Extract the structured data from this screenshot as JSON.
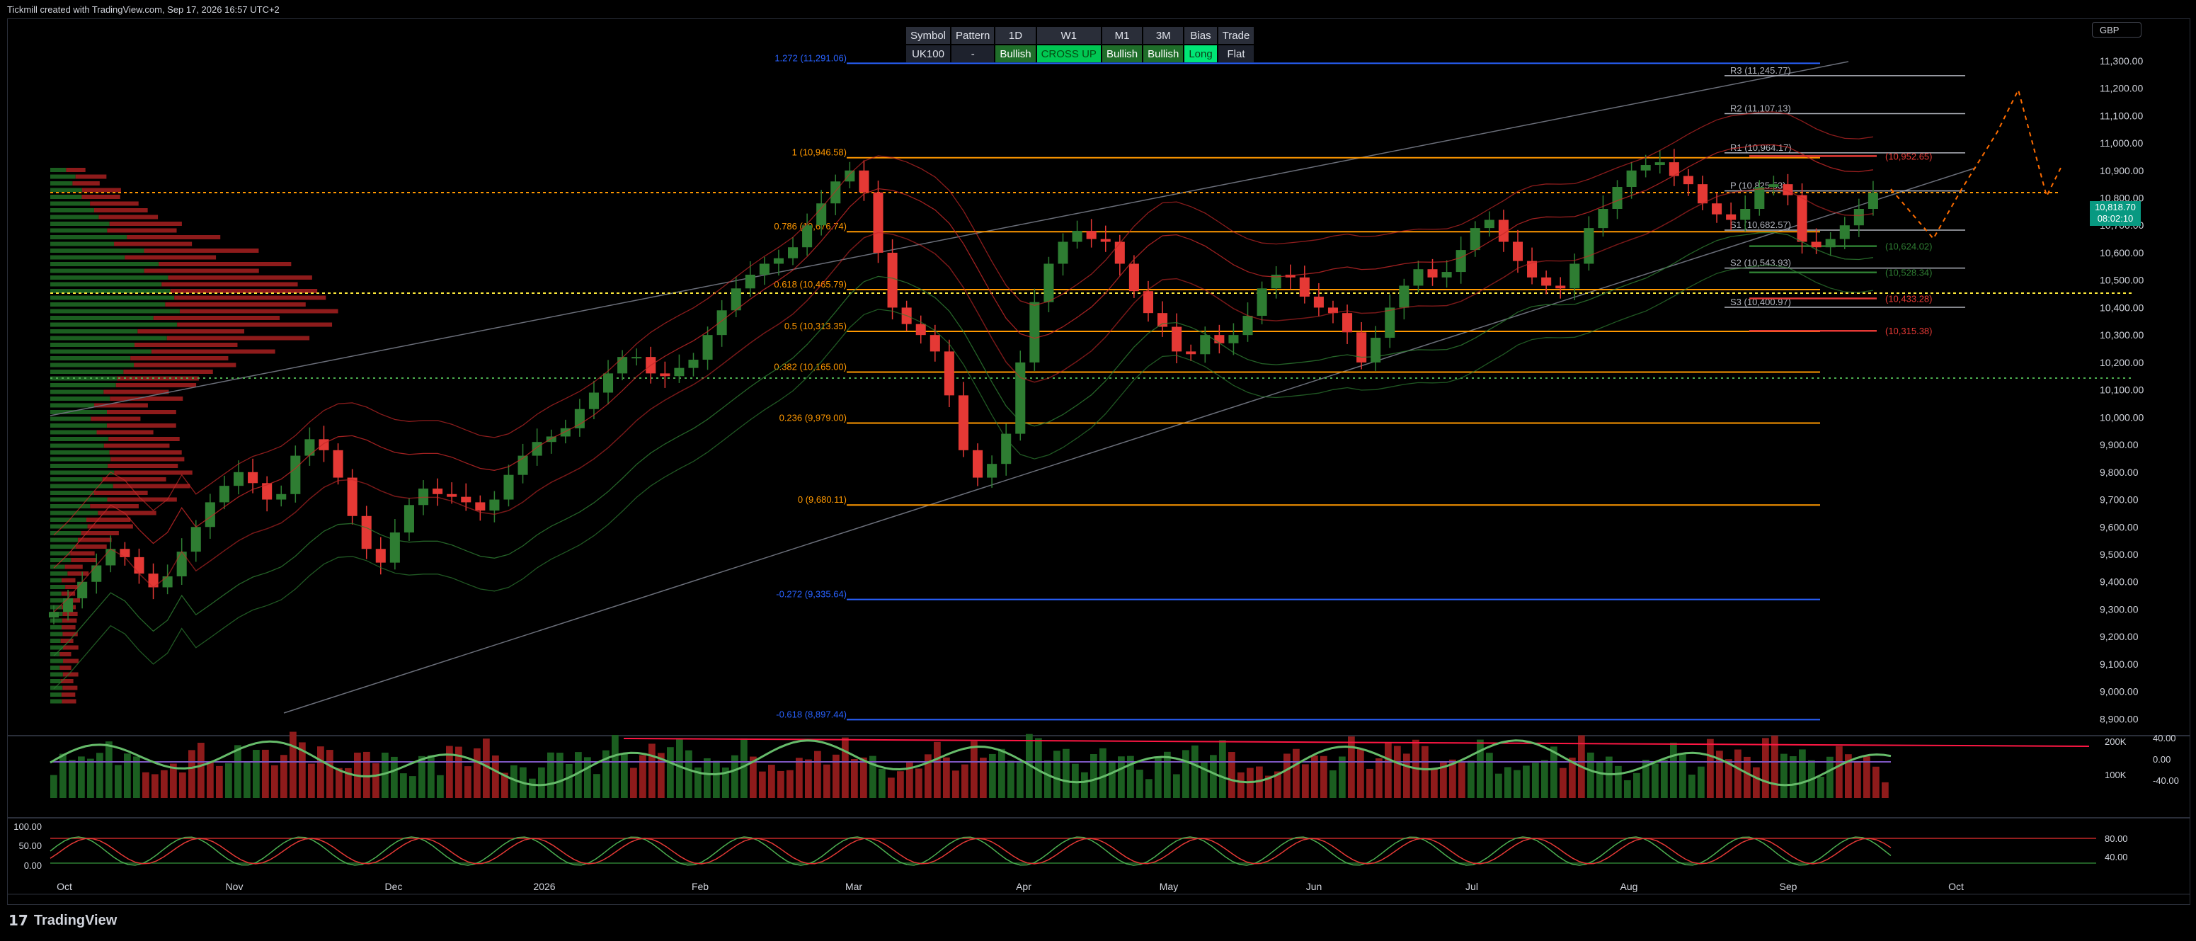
{
  "credit": "Tickmill created with TradingView.com, Sep 17, 2026 16:57 UTC+2",
  "footer": {
    "brand": "TradingView"
  },
  "currency": "GBP",
  "last_price": {
    "value": "10,818.70",
    "countdown": "08:02:10"
  },
  "info_table": {
    "headers": [
      "Symbol",
      "Pattern",
      "1D",
      "W1",
      "M1",
      "3M",
      "Bias",
      "Trade"
    ],
    "values": [
      "UK100",
      "-",
      "Bullish",
      "CROSS UP",
      "Bullish",
      "Bullish",
      "Long",
      "Flat"
    ]
  },
  "colors": {
    "up": "#2e7d32",
    "down": "#e53935",
    "fib": "#ff9800",
    "fib_ext": "#2962ff",
    "pivot": "#b2b5be",
    "bb": "#c62828",
    "bb_green": "#2e7d32"
  },
  "chart_data": [
    {
      "type": "candlestick",
      "title": "",
      "price_axis": [
        "11,300.00",
        "11,200.00",
        "11,100.00",
        "11,000.00",
        "10,900.00",
        "10,800.00",
        "10,700.00",
        "10,600.00",
        "10,500.00",
        "10,400.00",
        "10,300.00",
        "10,200.00",
        "10,100.00",
        "10,000.00",
        "9,900.00",
        "9,800.00",
        "9,700.00",
        "9,600.00",
        "9,500.00",
        "9,400.00",
        "9,300.00",
        "9,200.00",
        "9,100.00",
        "9,000.00",
        "8,900.00"
      ],
      "ylim": [
        8870,
        11390
      ],
      "time_axis": [
        "Oct",
        "Nov",
        "Dec",
        "2026",
        "Feb",
        "Mar",
        "Apr",
        "May",
        "Jun",
        "Jul",
        "Aug",
        "Sep",
        "Oct"
      ],
      "closes": [
        9290,
        9340,
        9400,
        9460,
        9520,
        9490,
        9430,
        9380,
        9420,
        9510,
        9600,
        9690,
        9750,
        9800,
        9760,
        9700,
        9720,
        9860,
        9920,
        9880,
        9780,
        9640,
        9520,
        9470,
        9580,
        9680,
        9740,
        9720,
        9710,
        9690,
        9660,
        9700,
        9790,
        9860,
        9910,
        9930,
        9960,
        10030,
        10090,
        10160,
        10220,
        10220,
        10160,
        10150,
        10180,
        10210,
        10300,
        10390,
        10470,
        10520,
        10560,
        10580,
        10620,
        10700,
        10780,
        10860,
        10900,
        10820,
        10600,
        10400,
        10340,
        10300,
        10240,
        10080,
        9880,
        9780,
        9830,
        9940,
        10200,
        10420,
        10560,
        10640,
        10680,
        10650,
        10640,
        10560,
        10460,
        10380,
        10330,
        10240,
        10230,
        10300,
        10270,
        10300,
        10370,
        10470,
        10520,
        10510,
        10440,
        10400,
        10380,
        10310,
        10200,
        10290,
        10400,
        10480,
        10540,
        10510,
        10530,
        10610,
        10690,
        10720,
        10640,
        10570,
        10510,
        10480,
        10470,
        10560,
        10690,
        10760,
        10840,
        10900,
        10920,
        10930,
        10880,
        10850,
        10780,
        10740,
        10720,
        10760,
        10840,
        10850,
        10810,
        10640,
        10620,
        10650,
        10700,
        10760,
        10818.7
      ],
      "fib_levels": [
        {
          "label": "1.272 (11,291.06)",
          "value": 11291.06,
          "color": "fib_ext"
        },
        {
          "label": "1 (10,946.58)",
          "value": 10946.58,
          "color": "fib"
        },
        {
          "label": "0.786 (10,676.74)",
          "value": 10676.74,
          "color": "fib"
        },
        {
          "label": "0.618 (10,465.79)",
          "value": 10465.79,
          "color": "fib"
        },
        {
          "label": "0.5 (10,313.35)",
          "value": 10313.35,
          "color": "fib"
        },
        {
          "label": "0.382 (10,165.00)",
          "value": 10165.0,
          "color": "fib"
        },
        {
          "label": "0.236 (9,979.00)",
          "value": 9979.0,
          "color": "fib"
        },
        {
          "label": "0 (9,680.11)",
          "value": 9680.11,
          "color": "fib"
        },
        {
          "label": "-0.272 (9,335.64)",
          "value": 9335.64,
          "color": "fib_ext"
        },
        {
          "label": "-0.618 (8,897.44)",
          "value": 8897.44,
          "color": "fib_ext"
        }
      ],
      "pivots": [
        {
          "label": "R3 (11,245.77)",
          "value": 11245.77
        },
        {
          "label": "R2 (11,107.13)",
          "value": 11107.13
        },
        {
          "label": "R1 (10,964.17)",
          "value": 10964.17
        },
        {
          "label": "P (10,825.53)",
          "value": 10825.53
        },
        {
          "label": "S1 (10,682.57)",
          "value": 10682.57
        },
        {
          "label": "S2 (10,543.93)",
          "value": 10543.93
        },
        {
          "label": "S3 (10,400.97)",
          "value": 10400.97
        }
      ],
      "annotations": [
        {
          "label": "(10,952.65)",
          "value": 10952.65,
          "color": "down"
        },
        {
          "label": "(10,624.02)",
          "value": 10624.02,
          "color": "up"
        },
        {
          "label": "(10,528.34)",
          "value": 10528.34,
          "color": "up"
        },
        {
          "label": "(10,433.28)",
          "value": 10433.28,
          "color": "down"
        },
        {
          "label": "(10,315.38)",
          "value": 10315.38,
          "color": "down"
        }
      ]
    },
    {
      "type": "bar",
      "title": "",
      "axis_labels": [
        "200K",
        "100K"
      ],
      "osc_axis": [
        "40.00",
        "0.00",
        "-40.00"
      ],
      "series": [
        {
          "values": [
            60,
            70,
            55,
            80,
            75,
            65,
            90,
            85,
            70,
            60,
            50,
            45,
            40,
            55,
            65,
            75,
            80,
            70,
            60,
            50,
            85,
            90,
            75,
            70,
            65,
            80,
            95,
            90,
            85,
            80,
            70,
            60,
            55,
            65,
            75,
            85,
            70,
            60,
            50,
            40
          ]
        }
      ]
    },
    {
      "type": "line",
      "title": "",
      "axis_labels": [
        "100.00",
        "50.00",
        "0.00"
      ],
      "right_axis": [
        "80.00",
        "40.00"
      ]
    }
  ]
}
